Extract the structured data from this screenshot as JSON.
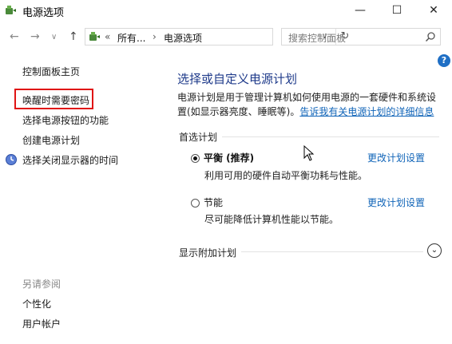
{
  "window": {
    "title": "电源选项",
    "minimize": "—",
    "maximize": "☐",
    "close": "✕"
  },
  "address": {
    "breadcrumbs": [
      "所有...",
      "电源选项"
    ],
    "overflow": "«",
    "separator": "›",
    "dropdown": "∨",
    "refresh": "↻",
    "search_placeholder": "搜索控制面板"
  },
  "nav": {
    "back": "←",
    "forward": "→",
    "history": "∨",
    "up": "↑"
  },
  "help": "?",
  "sidebar": {
    "links": [
      "控制面板主页",
      "唤醒时需要密码",
      "选择电源按钮的功能",
      "创建电源计划",
      "选择关闭显示器的时间"
    ],
    "see_also_title": "另请参阅",
    "see_also": [
      "个性化",
      "用户帐户"
    ]
  },
  "main": {
    "title": "选择或自定义电源计划",
    "description": "电源计划是用于管理计算机如何使用电源的一套硬件和系统设置(如显示器亮度、睡眠等)。",
    "description_link": "告诉我有关电源计划的详细信息",
    "preferred_title": "首选计划",
    "plans": [
      {
        "name": "平衡 (推荐)",
        "desc": "利用可用的硬件自动平衡功耗与性能。",
        "link": "更改计划设置",
        "selected": true
      },
      {
        "name": "节能",
        "desc": "尽可能降低计算机性能以节能。",
        "link": "更改计划设置",
        "selected": false
      }
    ],
    "additional_title": "显示附加计划",
    "expand": "⌄"
  }
}
